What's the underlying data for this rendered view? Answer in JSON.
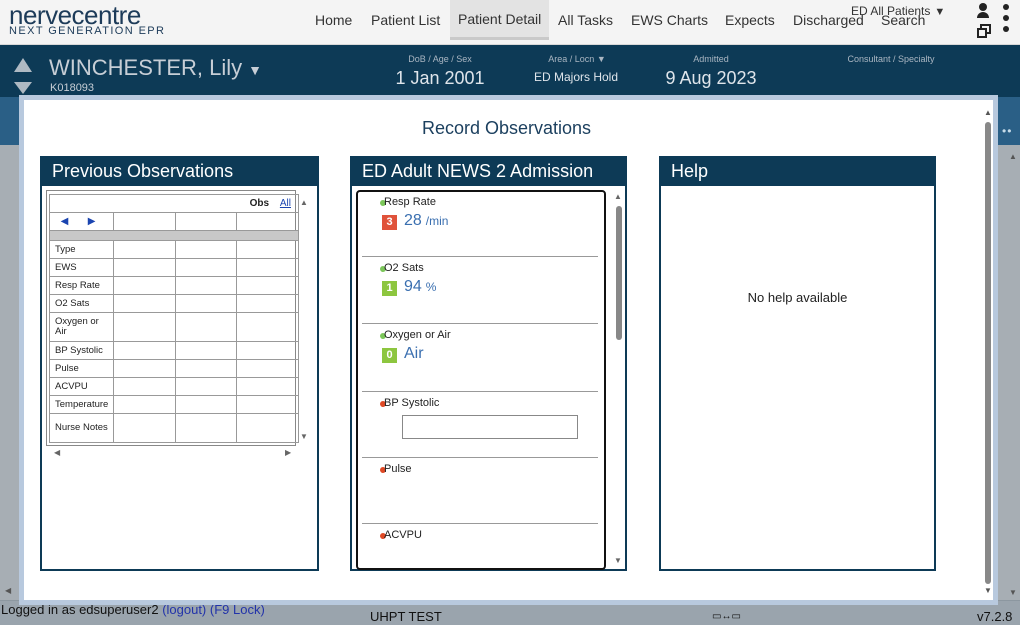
{
  "app": {
    "logo_name": "nervecentre",
    "logo_sub": "NEXT GENERATION EPR"
  },
  "nav": {
    "items": [
      "Home",
      "Patient List",
      "Patient Detail",
      "All Tasks",
      "EWS Charts",
      "Expects",
      "Discharged"
    ],
    "active": "Patient Detail",
    "ward_filter": "ED All Patients",
    "search_label": "Search"
  },
  "patient": {
    "name": "WINCHESTER, Lily",
    "id": "K018093",
    "dob_label": "DoB / Age / Sex",
    "dob": "1 Jan 2001",
    "area_label": "Area / Locn",
    "area": "ED Majors Hold",
    "admitted_label": "Admitted",
    "admitted": "9 Aug 2023",
    "consultant_label": "Consultant / Specialty",
    "consultant": ""
  },
  "modal": {
    "title": "Record Observations",
    "previous": {
      "title": "Previous Observations",
      "obs_label": "Obs",
      "all_link": "All",
      "rows": [
        "Type",
        "EWS",
        "Resp Rate",
        "O2 Sats",
        "Oxygen or Air",
        "BP Systolic",
        "Pulse",
        "ACVPU",
        "Temperature",
        "Nurse Notes"
      ]
    },
    "form": {
      "title": "ED Adult NEWS 2 Admission",
      "items": [
        {
          "name": "Resp Rate",
          "status": "green",
          "score": "3",
          "score_color": "#e0523a",
          "value": "28",
          "unit": "/min"
        },
        {
          "name": "O2 Sats",
          "status": "green",
          "score": "1",
          "score_color": "#8dc63f",
          "value": "94",
          "unit": "%"
        },
        {
          "name": "Oxygen or Air",
          "status": "green",
          "score": "0",
          "score_color": "#8dc63f",
          "value": "Air",
          "unit": ""
        },
        {
          "name": "BP Systolic",
          "status": "red",
          "input_value": ""
        },
        {
          "name": "Pulse",
          "status": "red"
        },
        {
          "name": "ACVPU",
          "status": "red"
        }
      ]
    },
    "help": {
      "title": "Help",
      "text": "No help available"
    }
  },
  "status": {
    "logged_in": "Logged in as edsuperuser2",
    "logout": "(logout)",
    "lock": "(F9 Lock)",
    "environment": "UHPT TEST",
    "version": "v7.2.8"
  }
}
